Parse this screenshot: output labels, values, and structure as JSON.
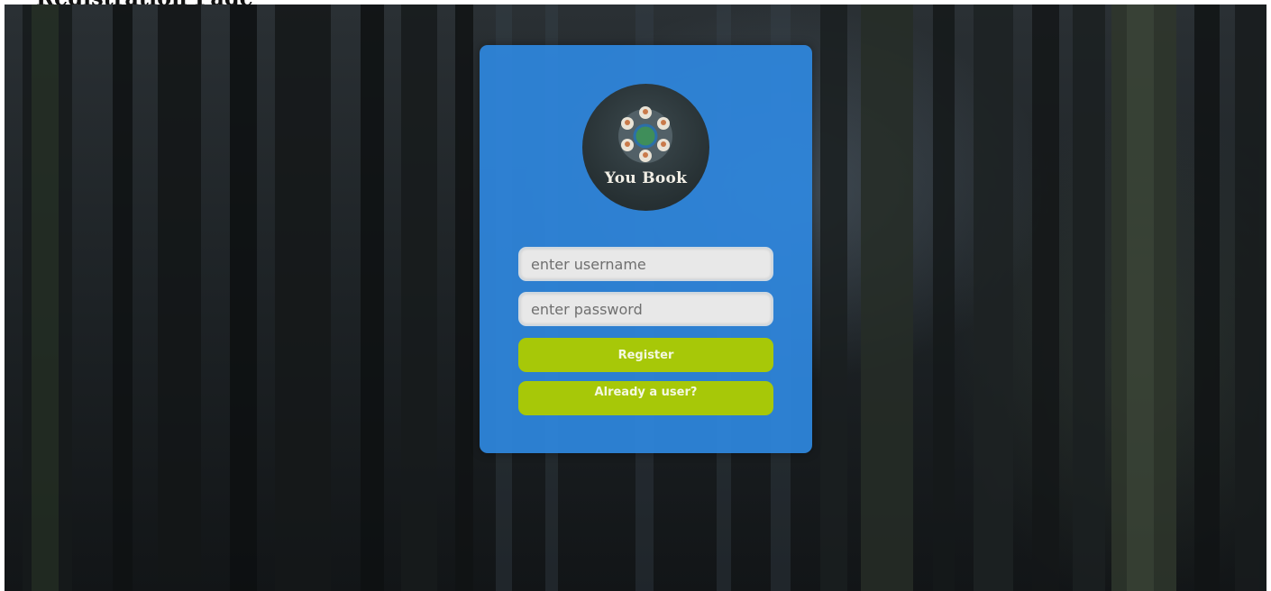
{
  "heading": "Registration Page",
  "logo": {
    "text": "You Book"
  },
  "form": {
    "username_placeholder": "enter username",
    "password_placeholder": "enter password",
    "register_label": "Register",
    "already_user_label": "Already a user?"
  },
  "colors": {
    "card": "#2e86de",
    "button": "#a7c808",
    "field": "#e8e8e8"
  }
}
